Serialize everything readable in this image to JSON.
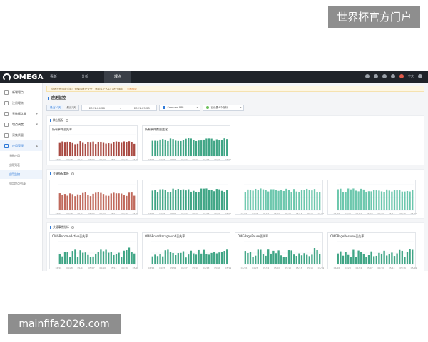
{
  "watermarks": {
    "top": "世界杯官方门户",
    "bottom": "mainfifa2026.com"
  },
  "topnav": {
    "logo": "OMEGA",
    "tabs": [
      {
        "label": "看板"
      },
      {
        "label": "分析"
      },
      {
        "label": "埋点"
      }
    ],
    "lang": "中文"
  },
  "sidebar": {
    "items": [
      {
        "label": "新增埋点",
        "icon": "file-icon"
      },
      {
        "label": "注册埋点",
        "icon": "list-icon"
      },
      {
        "label": "元数据字典",
        "icon": "book-icon",
        "expandable": true
      },
      {
        "label": "埋点调度",
        "icon": "settings-icon",
        "expandable": true
      },
      {
        "label": "采集质量",
        "icon": "tree-icon"
      },
      {
        "label": "应用管理",
        "icon": "app-icon",
        "expandable": true,
        "expanded": true
      }
    ],
    "subitems": [
      {
        "label": "注册应用",
        "active": false
      },
      {
        "label": "应用列表",
        "active": false
      },
      {
        "label": "应用监控",
        "active": true
      },
      {
        "label": "应用埋点列表",
        "active": false
      }
    ]
  },
  "main": {
    "notice": {
      "text": "您还没有绑定手机？为保障账户安全，请前往个人中心进行绑定",
      "link": "立即绑定"
    },
    "page_title": "应用监控",
    "filters": {
      "segment": [
        "最近30天",
        "最近7天"
      ],
      "date_from": "2021-04-26",
      "date_to": "2021-05-25",
      "app_select": "Sampler APP",
      "status_select": "已设置4个指标"
    },
    "sections": [
      {
        "title": "核心指标"
      },
      {
        "title": "关键指标看板"
      },
      {
        "title": "关键事件指标"
      }
    ],
    "cards": [
      {
        "title": "所有事件丢失率",
        "color": "#a94a42",
        "section": 0
      },
      {
        "title": "所有事件数量变化",
        "color": "#3fa585",
        "section": 0
      },
      {
        "title": "",
        "color": "#c06a5c",
        "section": 1
      },
      {
        "title": "",
        "color": "#3fa585",
        "section": 1
      },
      {
        "title": "",
        "color": "#6cc7ad",
        "section": 1
      },
      {
        "title": "",
        "color": "#6cc7ad",
        "section": 1
      },
      {
        "title": "OMGBecomeActive丢失率",
        "color": "#3fa585",
        "section": 2
      },
      {
        "title": "OMGEnterBackground丢失率",
        "color": "#3fa585",
        "section": 2
      },
      {
        "title": "OMGPagePause丢失率",
        "color": "#3fa585",
        "section": 2
      },
      {
        "title": "OMGPageResume丢失率",
        "color": "#3fa585",
        "section": 2
      }
    ],
    "x_ticks": [
      "04/26",
      "04/28",
      "05/04",
      "05/07",
      "05/10",
      "05/13",
      "05/16",
      "05/19",
      "05/22",
      "05/24"
    ]
  }
}
